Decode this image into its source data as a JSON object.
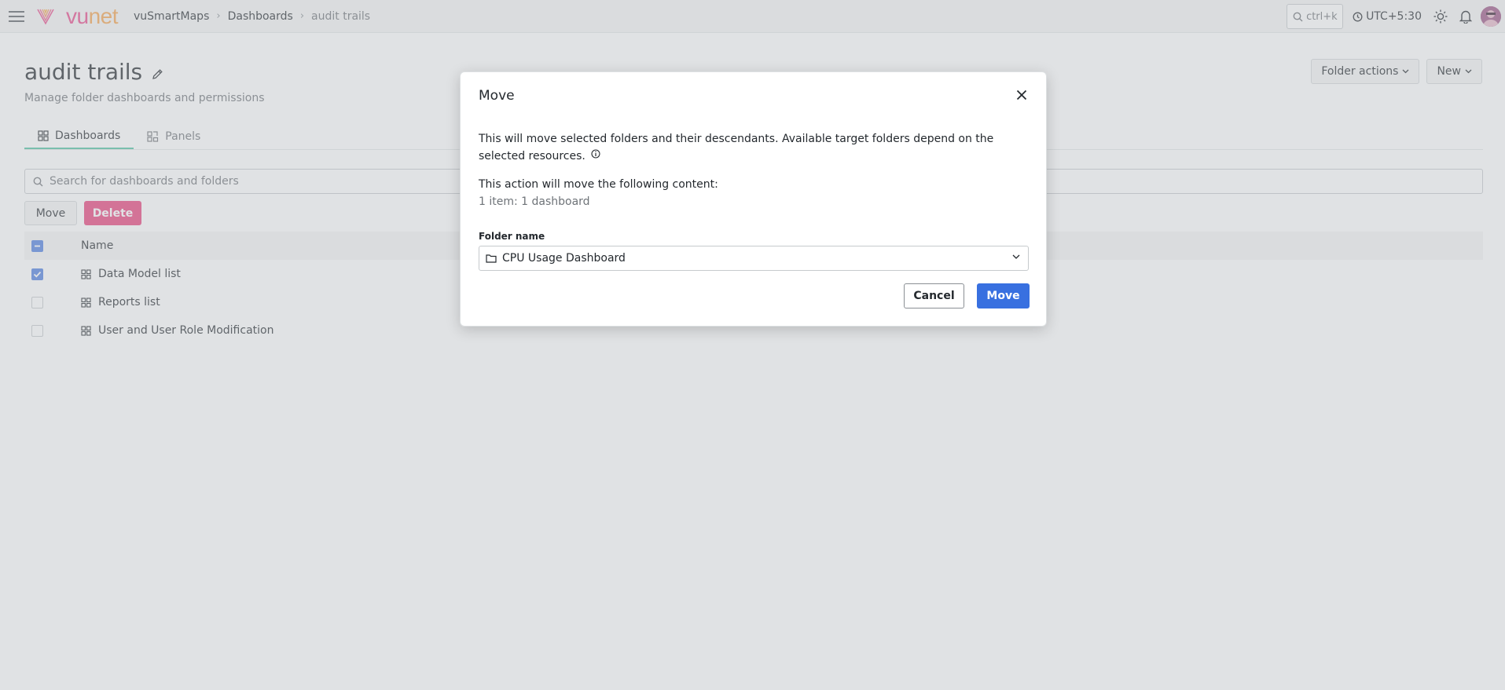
{
  "topbar": {
    "logo_text_vu": "vu",
    "logo_text_net": "net",
    "breadcrumbs": [
      "vuSmartMaps",
      "Dashboards",
      "audit trails"
    ],
    "search_hint": "ctrl+k",
    "timezone": "UTC+5:30"
  },
  "page": {
    "title": "audit trails",
    "subtitle": "Manage folder dashboards and permissions",
    "folder_actions_label": "Folder actions",
    "new_label": "New",
    "tabs": [
      {
        "label": "Dashboards",
        "active": true
      },
      {
        "label": "Panels",
        "active": false
      }
    ],
    "search_placeholder": "Search for dashboards and folders",
    "move_label": "Move",
    "delete_label": "Delete",
    "table": {
      "header_name": "Name",
      "rows": [
        {
          "name": "Data Model list",
          "checked": true
        },
        {
          "name": "Reports list",
          "checked": false
        },
        {
          "name": "User and User Role Modification",
          "checked": false
        }
      ]
    }
  },
  "modal": {
    "title": "Move",
    "description": "This will move selected folders and their descendants. Available target folders depend on the selected resources.",
    "action_text": "This action will move the following content:",
    "count_text": "1 item: 1 dashboard",
    "field_label": "Folder name",
    "folder_value": "CPU Usage Dashboard",
    "cancel_label": "Cancel",
    "move_label": "Move"
  },
  "colors": {
    "accent_blue": "#3870e0",
    "delete_pink": "#e8417a",
    "tab_underline": "#4fc3a1",
    "checkbox_blue": "#4f7fe0"
  }
}
